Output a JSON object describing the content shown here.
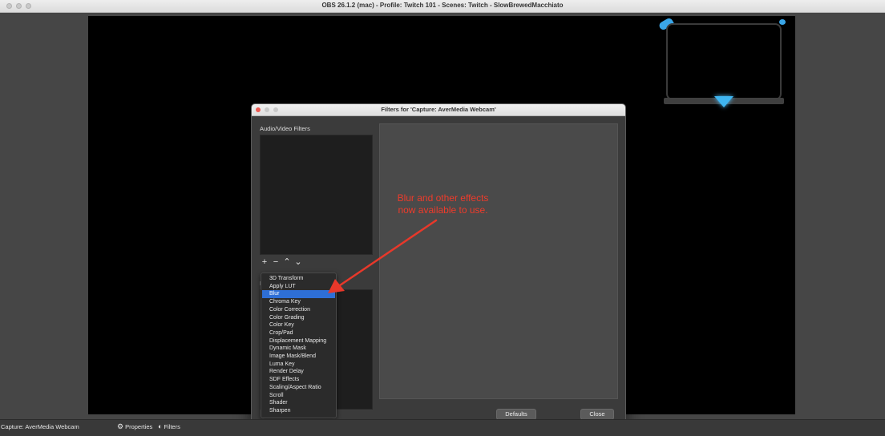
{
  "window": {
    "title": "OBS 26.1.2 (mac) - Profile: Twitch 101 - Scenes: Twitch - SlowBrewedMacchiato"
  },
  "dialog": {
    "title": "Filters for 'Capture: AverMedia Webcam'",
    "audio_video_label": "Audio/Video Filters",
    "effect_label_partial": "E",
    "toolbar": {
      "add": "+",
      "remove": "−",
      "up": "⌃",
      "down": "⌄"
    },
    "defaults_label": "Defaults",
    "close_label": "Close"
  },
  "menu": {
    "items": [
      "3D Transform",
      "Apply LUT",
      "Blur",
      "Chroma Key",
      "Color Correction",
      "Color Grading",
      "Color Key",
      "Crop/Pad",
      "Displacement Mapping",
      "Dynamic Mask",
      "Image Mask/Blend",
      "Luma Key",
      "Render Delay",
      "SDF Effects",
      "Scaling/Aspect Ratio",
      "Scroll",
      "Shader",
      "Sharpen"
    ],
    "selected": "Blur"
  },
  "annotation": {
    "line1": "Blur and other effects",
    "line2": "now available to use.",
    "color": "#ee3b2b"
  },
  "bottom_bar": {
    "source_label": "Capture: AverMedia Webcam",
    "properties_label": "Properties",
    "filters_label": "Filters"
  },
  "colors": {
    "accent": "#2e6fd6",
    "overlay_blue": "#3fb6f2"
  }
}
